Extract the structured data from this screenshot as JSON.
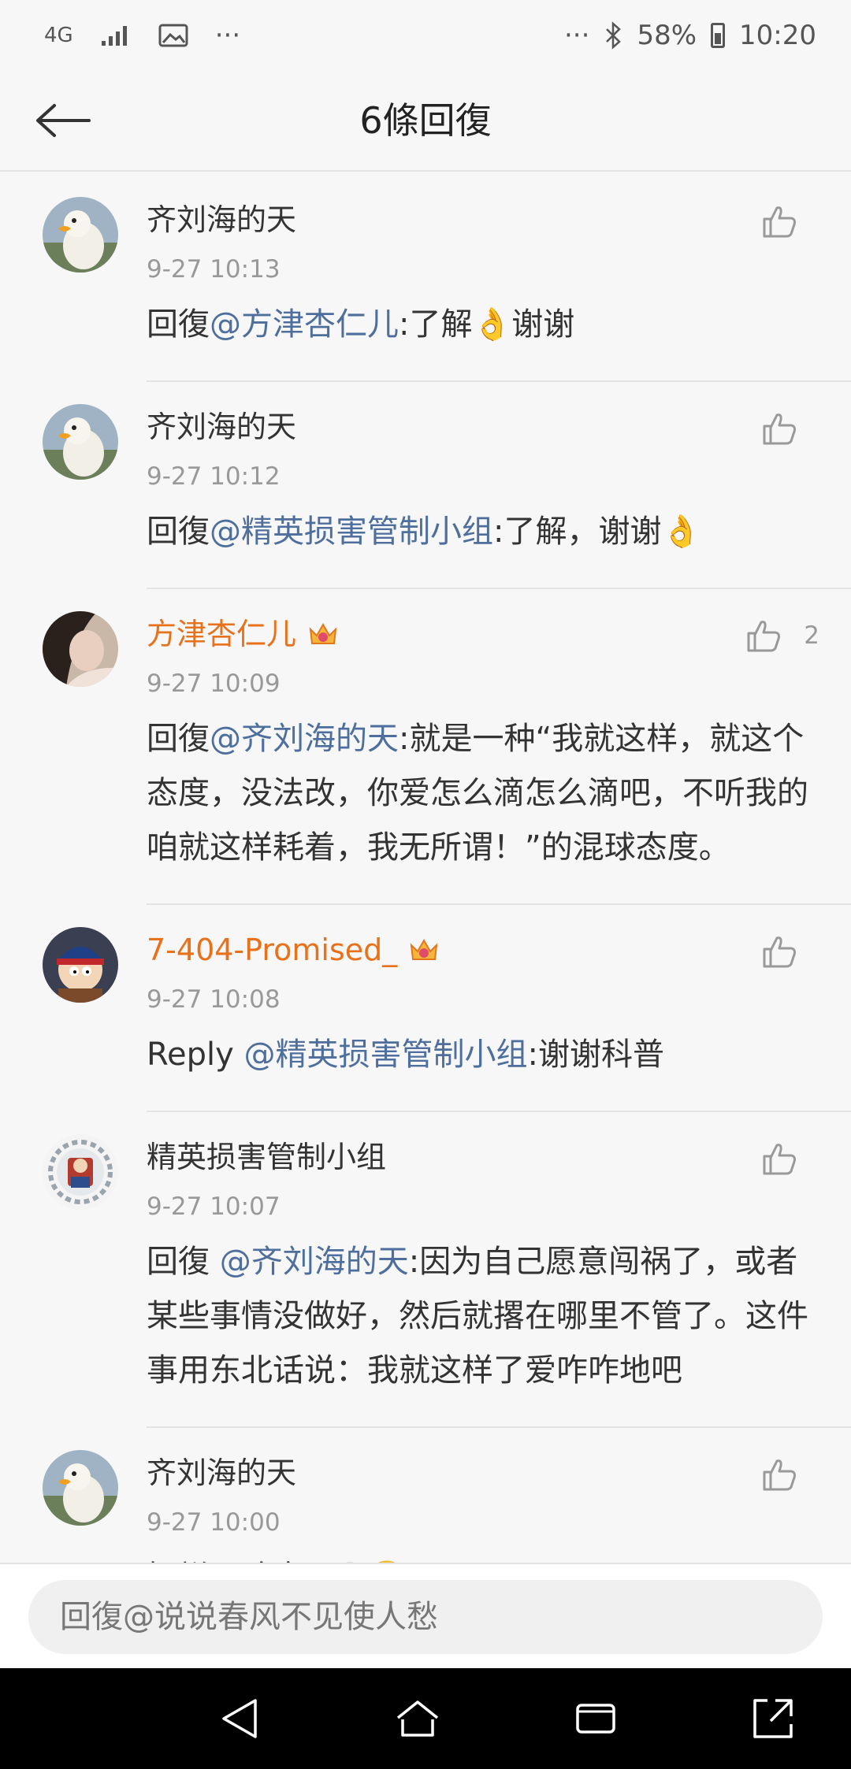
{
  "status_bar": {
    "network": "4G",
    "more_left": "···",
    "more_right": "···",
    "battery": "58%",
    "time": "10:20"
  },
  "header": {
    "title": "6條回復"
  },
  "comments": [
    {
      "name": "齐刘海的天",
      "vip": false,
      "time": "9-27 10:13",
      "prefix": "回復",
      "mention": "@方津杏仁儿",
      "body": ":了解👌谢谢",
      "likes": "",
      "avatar": "duck"
    },
    {
      "name": "齐刘海的天",
      "vip": false,
      "time": "9-27 10:12",
      "prefix": "回復",
      "mention": "@精英损害管制小组",
      "body": ":了解，谢谢👌",
      "likes": "",
      "avatar": "duck"
    },
    {
      "name": "方津杏仁儿",
      "vip": true,
      "time": "9-27 10:09",
      "prefix": "回復",
      "mention": "@齐刘海的天",
      "body": ":就是一种“我就这样，就这个态度，没法改，你爱怎么滴怎么滴吧，不听我的咱就这样耗着，我无所谓！”的混球态度。",
      "likes": "2",
      "avatar": "portrait"
    },
    {
      "name": "7-404-Promised_",
      "vip": true,
      "time": "9-27 10:08",
      "prefix": "Reply ",
      "mention": "@精英损害管制小组",
      "body": ":谢谢科普",
      "likes": "",
      "avatar": "cartoon"
    },
    {
      "name": "精英损害管制小组",
      "vip": false,
      "time": "9-27 10:07",
      "prefix": "回復 ",
      "mention": "@齐刘海的天",
      "body": ":因为自己愿意闯祸了，或者某些事情没做好，然后就撂在哪里不管了。这件事用东北话说：我就这样了爱咋咋地吧",
      "likes": "",
      "avatar": "gear"
    },
    {
      "name": "齐刘海的天",
      "vip": false,
      "time": "9-27 10:00",
      "prefix": "",
      "mention": "",
      "body": "摆烂是啥意思啊🙄",
      "likes": "",
      "avatar": "duck"
    }
  ],
  "reply_bar": {
    "placeholder": "回復@说说春风不见使人愁"
  },
  "icons": {
    "back": "arrow-left-icon",
    "like": "thumbs-up-icon",
    "crown": "crown-badge-icon",
    "nav_back": "triangle-back-icon",
    "nav_home": "home-icon",
    "nav_recent": "recent-apps-icon",
    "nav_expand": "expand-icon"
  },
  "colors": {
    "mention": "#4e6f9d",
    "vip_name": "#e8721c",
    "time": "#999999"
  }
}
